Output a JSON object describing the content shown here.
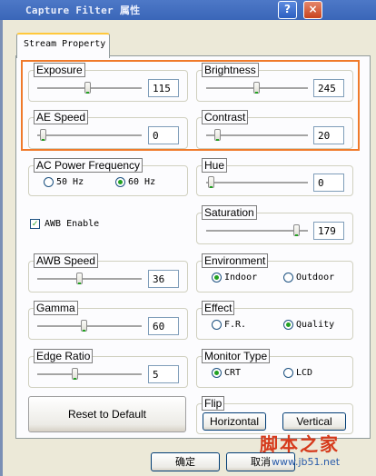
{
  "window": {
    "title": "Capture Filter 属性",
    "help_btn": "?",
    "close_btn": "×"
  },
  "tab": {
    "label": "Stream Property"
  },
  "sliders": {
    "exposure": {
      "label": "Exposure",
      "value": "115"
    },
    "brightness": {
      "label": "Brightness",
      "value": "245"
    },
    "ae_speed": {
      "label": "AE Speed",
      "value": "0"
    },
    "contrast": {
      "label": "Contrast",
      "value": "20"
    },
    "hue": {
      "label": "Hue",
      "value": "0"
    },
    "saturation": {
      "label": "Saturation",
      "value": "179"
    },
    "awb_speed": {
      "label": "AWB Speed",
      "value": "36"
    },
    "gamma": {
      "label": "Gamma",
      "value": "60"
    },
    "edge_ratio": {
      "label": "Edge Ratio",
      "value": "5"
    }
  },
  "ac_power": {
    "label": "AC Power Frequency",
    "opt1": "50 Hz",
    "opt2": "60 Hz",
    "selected": "60 Hz"
  },
  "awb_enable": {
    "label": "AWB Enable",
    "checked": true
  },
  "environment": {
    "label": "Environment",
    "opt1": "Indoor",
    "opt2": "Outdoor",
    "selected": "Indoor"
  },
  "effect": {
    "label": "Effect",
    "opt1": "F.R.",
    "opt2": "Quality",
    "selected": "Quality"
  },
  "monitor_type": {
    "label": "Monitor Type",
    "opt1": "CRT",
    "opt2": "LCD",
    "selected": "CRT"
  },
  "flip": {
    "label": "Flip",
    "horizontal": "Horizontal",
    "vertical": "Vertical"
  },
  "reset_label": "Reset to Default",
  "footer": {
    "ok": "确定",
    "cancel": "取消"
  },
  "watermark": {
    "top": "脚本之家",
    "bottom": "www.jb51.net"
  },
  "colors": {
    "highlight": "#f07a2a",
    "title_bar": "#3a66b8",
    "panel": "#fcfcfe",
    "thumb_accent": "#21a121"
  }
}
